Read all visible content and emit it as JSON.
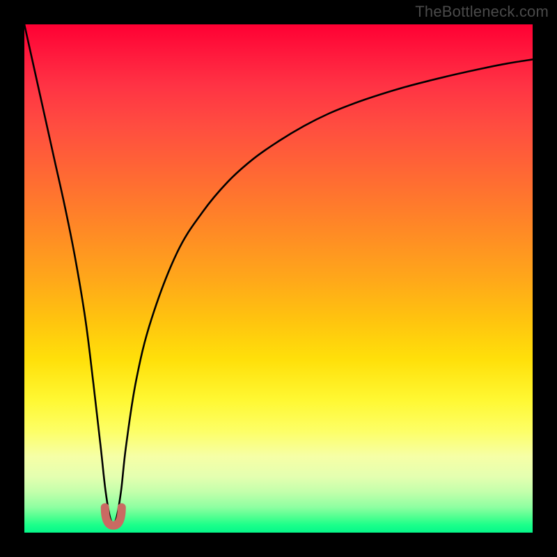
{
  "watermark": "TheBottleneck.com",
  "chart_data": {
    "type": "line",
    "title": "",
    "xlabel": "",
    "ylabel": "",
    "xlim": [
      0,
      100
    ],
    "ylim": [
      0,
      100
    ],
    "series": [
      {
        "name": "bottleneck-curve",
        "x": [
          0,
          2,
          4,
          6,
          8,
          10,
          12,
          13.5,
          15,
          16,
          17,
          18,
          19,
          20,
          22,
          25,
          30,
          35,
          40,
          45,
          50,
          55,
          60,
          65,
          70,
          75,
          80,
          85,
          90,
          95,
          100
        ],
        "values": [
          100,
          91,
          82,
          73,
          64,
          54,
          42,
          30,
          17,
          8,
          2.5,
          2.5,
          8,
          17,
          30,
          42,
          55,
          63,
          69,
          73.5,
          77,
          80,
          82.5,
          84.5,
          86.2,
          87.7,
          89,
          90.2,
          91.3,
          92.3,
          93.1
        ]
      }
    ],
    "annotations": [
      {
        "name": "minimum-marker",
        "x": 17.5,
        "y": 2.5,
        "color": "#c96a62"
      }
    ],
    "gradient_stops": [
      {
        "pos": 0,
        "color": "#ff0033"
      },
      {
        "pos": 50,
        "color": "#ffa71a"
      },
      {
        "pos": 80,
        "color": "#fdff66"
      },
      {
        "pos": 100,
        "color": "#06f789"
      }
    ]
  }
}
